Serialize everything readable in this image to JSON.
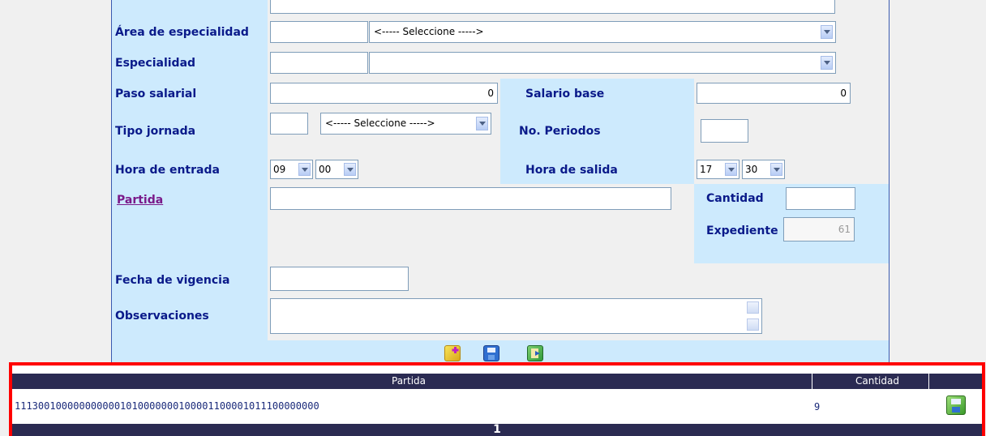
{
  "form": {
    "area_label": "Área de especialidad",
    "area_select": "<----- Seleccione ----->",
    "especialidad_label": "Especialidad",
    "especialidad_select": "",
    "paso_label": "Paso salarial",
    "paso_value": "0",
    "salario_label": "Salario base",
    "salario_value": "0",
    "tipo_label": "Tipo jornada",
    "tipo_select": "<----- Seleccione ----->",
    "periodos_label": "No. Periodos",
    "entrada_label": "Hora de entrada",
    "entrada_hour": "09",
    "entrada_min": "00",
    "salida_label": "Hora de salida",
    "salida_hour": "17",
    "salida_min": "30",
    "partida_link": "Partida",
    "cantidad_label": "Cantidad",
    "expediente_label": "Expediente",
    "expediente_value": "61",
    "vigencia_label": "Fecha de vigencia",
    "observ_label": "Observaciones"
  },
  "toolbar": {
    "icons": [
      "new-icon",
      "save-icon",
      "exit-icon"
    ]
  },
  "grid": {
    "headers": [
      "Partida",
      "Cantidad"
    ],
    "rows": [
      {
        "partida": "1113001000000000001010000000100001100001011100000000",
        "cantidad": "9"
      }
    ],
    "pager": "1"
  },
  "colors": {
    "label": "#0a1a8a",
    "panel": "#cdeafd",
    "grid_header": "#2b2b52",
    "highlight": "#ff0000"
  }
}
